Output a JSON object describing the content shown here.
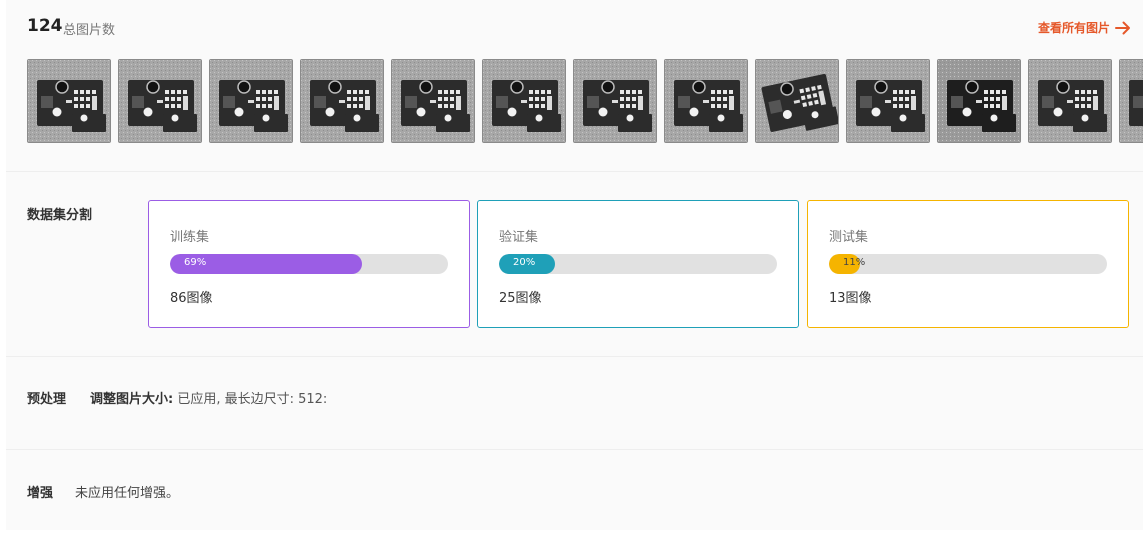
{
  "header": {
    "image_count": "124",
    "image_count_label": "总图片数",
    "view_all_label": "查看所有图片",
    "view_all_icon": "arrow-right-icon",
    "accent_color": "#e5582a"
  },
  "thumbnails": [
    {
      "variant": "standard"
    },
    {
      "variant": "standard"
    },
    {
      "variant": "standard"
    },
    {
      "variant": "standard"
    },
    {
      "variant": "standard"
    },
    {
      "variant": "standard"
    },
    {
      "variant": "standard"
    },
    {
      "variant": "standard"
    },
    {
      "variant": "rotated"
    },
    {
      "variant": "standard"
    },
    {
      "variant": "dark"
    },
    {
      "variant": "standard"
    },
    {
      "variant": "standard"
    }
  ],
  "split": {
    "title": "数据集分割",
    "train": {
      "label": "训练集",
      "percent_text": "69%",
      "fraction": 0.69,
      "count_text": "86图像",
      "color": "#9b5de5"
    },
    "valid": {
      "label": "验证集",
      "percent_text": "20%",
      "fraction": 0.2,
      "count_text": "25图像",
      "color": "#1fa0b8"
    },
    "test": {
      "label": "测试集",
      "percent_text": "11%",
      "fraction": 0.11,
      "count_text": "13图像",
      "color": "#f5b400"
    }
  },
  "preprocessing": {
    "title": "预处理",
    "key": "调整图片大小:",
    "value": " 已应用, 最长边尺寸: 512:"
  },
  "augmentation": {
    "title": "增强",
    "value": "未应用任何增强。"
  }
}
